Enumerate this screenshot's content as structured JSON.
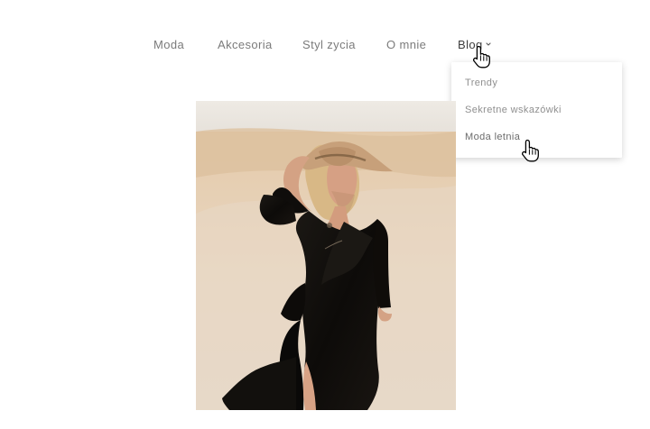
{
  "nav": {
    "items": [
      {
        "label": "Moda"
      },
      {
        "label": "Akcesoria"
      },
      {
        "label": "Styl zycia"
      },
      {
        "label": "O mnie"
      },
      {
        "label": "Blog"
      }
    ]
  },
  "dropdown": {
    "items": [
      {
        "label": "Trendy"
      },
      {
        "label": "Sekretne wskazówki"
      },
      {
        "label": "Moda letnia"
      }
    ]
  },
  "icons": {
    "chevron": "chevron-down-icon",
    "cursor": "hand-pointer-cursor-icon"
  },
  "colors": {
    "nav_text": "#7b7b7b",
    "nav_active": "#3d3d3d",
    "dropdown_text": "#8f8f8f",
    "dress": "#0c0b0a",
    "hat": "#c7a07a",
    "sand": "#e5d3bb",
    "skin": "#d7a285"
  }
}
